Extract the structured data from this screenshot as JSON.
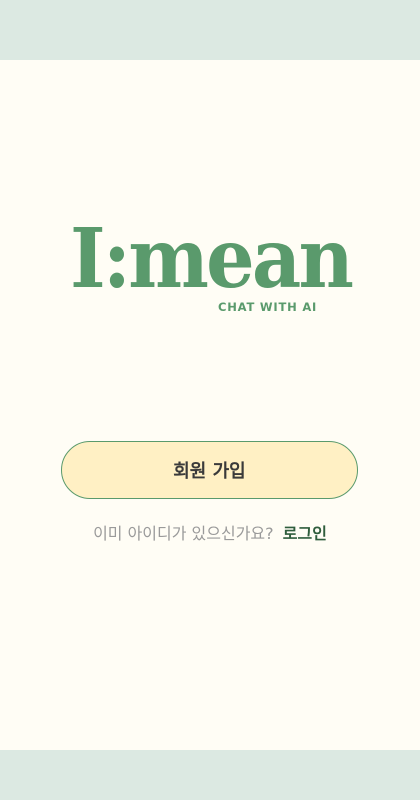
{
  "logo": {
    "wordmark": "I:mean",
    "tagline": "CHAT WITH AI"
  },
  "signup": {
    "label": "회원 가입"
  },
  "login": {
    "prompt": "이미 아이디가 있으신가요?",
    "link_label": "로그인"
  },
  "colors": {
    "brand_green": "#5a9a6c",
    "background": "#fffdf5",
    "outer_band": "#dce9e2",
    "button_fill": "#fff0c4",
    "login_link": "#2f5d3c"
  }
}
